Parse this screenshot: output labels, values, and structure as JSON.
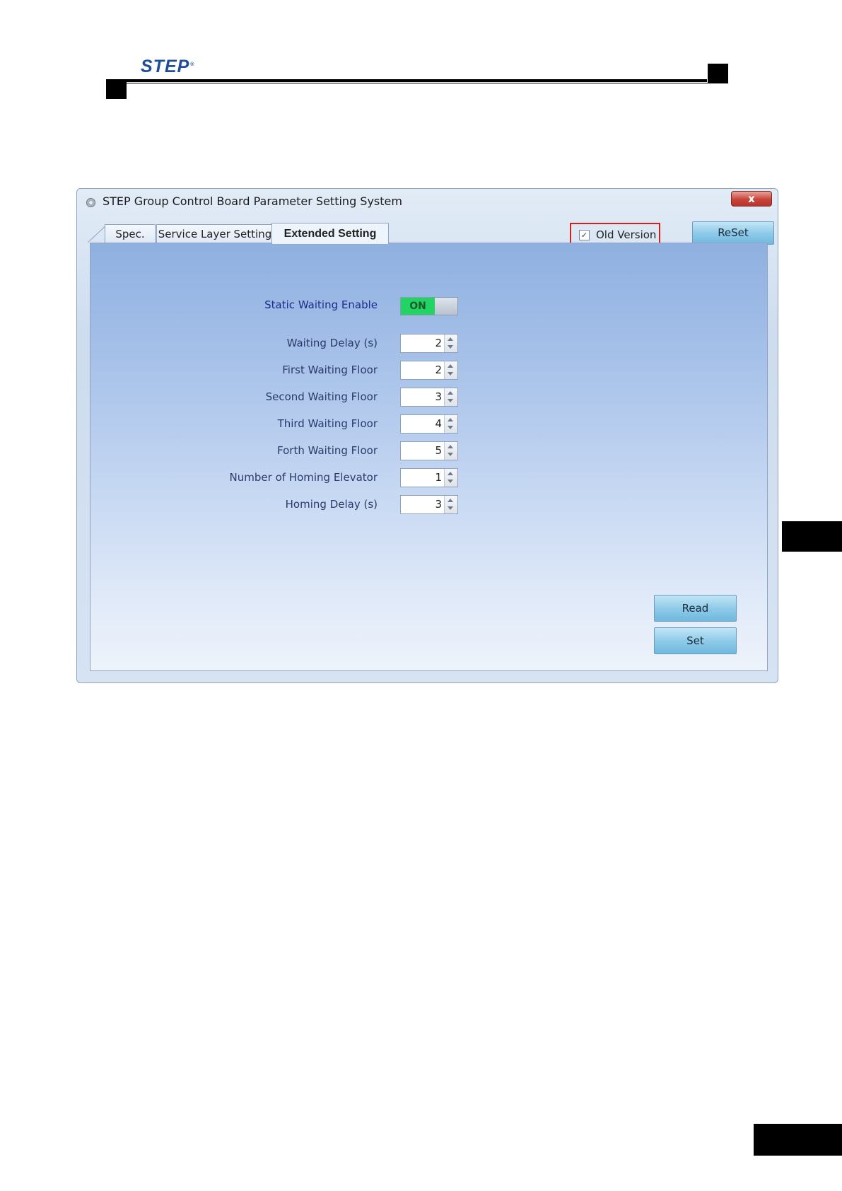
{
  "page": {
    "logo": "STEP",
    "logo_mark": "®"
  },
  "window": {
    "title": "STEP Group Control Board Parameter Setting System",
    "close_label": "x"
  },
  "tabs": [
    {
      "label": "Spec.",
      "active": false
    },
    {
      "label": "Service Layer Setting",
      "active": false
    },
    {
      "label": "Extended Setting",
      "active": true
    }
  ],
  "toolbar": {
    "old_version_label": "Old Version",
    "old_version_checked": true,
    "old_version_check_mark": "✓",
    "reset_label": "ReSet"
  },
  "static_waiting": {
    "label": "Static Waiting Enable",
    "state": "ON"
  },
  "fields": [
    {
      "label": "Waiting Delay (s)",
      "value": "2"
    },
    {
      "label": "First Waiting Floor",
      "value": "2"
    },
    {
      "label": "Second Waiting Floor",
      "value": "3"
    },
    {
      "label": "Third Waiting Floor",
      "value": "4"
    },
    {
      "label": "Forth Waiting Floor",
      "value": "5"
    },
    {
      "label": "Number of Homing Elevator",
      "value": "1"
    },
    {
      "label": "Homing Delay (s)",
      "value": "3"
    }
  ],
  "actions": {
    "read_label": "Read",
    "set_label": "Set"
  }
}
